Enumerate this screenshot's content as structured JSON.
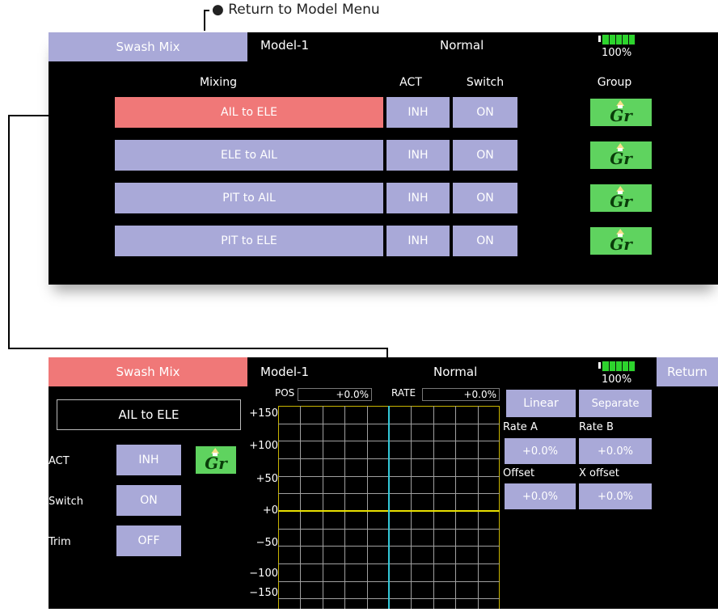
{
  "callout": {
    "return_label": "Return to Model Menu"
  },
  "top_screen": {
    "header": {
      "tab": "Swash Mix",
      "model": "Model-1",
      "condition": "Normal",
      "battery": "100%"
    },
    "columns": {
      "mixing": "Mixing",
      "act": "ACT",
      "switch": "Switch",
      "group": "Group"
    },
    "rows": [
      {
        "name": "AIL to ELE",
        "act": "INH",
        "switch": "ON",
        "group": "Gr"
      },
      {
        "name": "ELE to AIL",
        "act": "INH",
        "switch": "ON",
        "group": "Gr"
      },
      {
        "name": "PIT to AIL",
        "act": "INH",
        "switch": "ON",
        "group": "Gr"
      },
      {
        "name": "PIT to ELE",
        "act": "INH",
        "switch": "ON",
        "group": "Gr"
      }
    ]
  },
  "bottom_screen": {
    "header": {
      "tab": "Swash Mix",
      "model": "Model-1",
      "condition": "Normal",
      "battery": "100%",
      "return": "Return"
    },
    "mix_name": "AIL to ELE",
    "left": {
      "act_label": "ACT",
      "act_value": "INH",
      "group": "Gr",
      "switch_label": "Switch",
      "switch_value": "ON",
      "trim_label": "Trim",
      "trim_value": "OFF"
    },
    "graph": {
      "pos_label": "POS",
      "pos_value": "+0.0%",
      "rate_label": "RATE",
      "rate_value": "+0.0%",
      "y_ticks": [
        "+150",
        "+100",
        "+50",
        "+0",
        "−50",
        "−100",
        "−150"
      ]
    },
    "right": {
      "linear": "Linear",
      "separate": "Separate",
      "rate_a_label": "Rate A",
      "rate_b_label": "Rate B",
      "rate_a": "+0.0%",
      "rate_b": "+0.0%",
      "offset_label": "Offset",
      "x_offset_label": "X offset",
      "offset": "+0.0%",
      "x_offset": "+0.0%"
    },
    "colors": {
      "accent": "#f07878",
      "button": "#a9a9d8",
      "group": "#5fd35f",
      "yellow": "#e8e000",
      "cyan": "#33c8d8"
    }
  }
}
